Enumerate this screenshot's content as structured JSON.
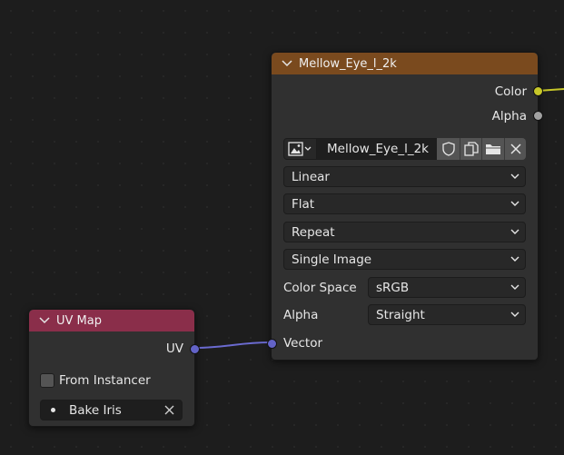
{
  "image_node": {
    "title": "Mellow_Eye_l_2k",
    "header_color": "#7a4a1e",
    "outputs": [
      {
        "label": "Color",
        "socket_color": "#c7c729"
      },
      {
        "label": "Alpha",
        "socket_color": "#a1a1a1"
      }
    ],
    "image_field": {
      "name": "Mellow_Eye_l_2k",
      "icons": [
        "image-browse-icon",
        "fake-user-shield-icon",
        "duplicate-icon",
        "open-folder-icon",
        "unlink-x-icon"
      ]
    },
    "interpolation": "Linear",
    "projection": "Flat",
    "extension": "Repeat",
    "source": "Single Image",
    "color_space_label": "Color Space",
    "color_space_value": "sRGB",
    "alpha_label": "Alpha",
    "alpha_value": "Straight",
    "input_label": "Vector",
    "input_socket_color": "#6363c7"
  },
  "uvmap_node": {
    "title": "UV Map",
    "header_color": "#8a2e4a",
    "output_label": "UV",
    "output_socket_color": "#6363c7",
    "from_instancer_label": "From Instancer",
    "from_instancer_checked": false,
    "uv_layer_value": "Bake Iris"
  },
  "link_color": "#6b6bd1",
  "color_link_color": "#c7c729"
}
